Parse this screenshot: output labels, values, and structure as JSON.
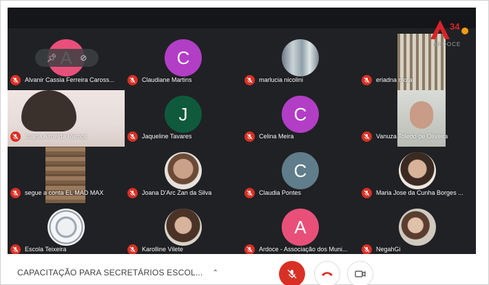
{
  "meeting": {
    "title": "CAPACITAÇÃO PARA SECRETÁRIOS ESCOL...",
    "expand_icon": "chevron-up-icon"
  },
  "logo": {
    "text": "ARDOCE",
    "number": "34"
  },
  "pinned_tile_initial": "A",
  "participants": [
    {
      "name": "Alvanir Cassia Ferreira Caross...",
      "kind": "initial",
      "initial": "A",
      "color": "#e8507a"
    },
    {
      "name": "Claudiane Martins",
      "kind": "initial",
      "initial": "C",
      "color": "#b23ec6"
    },
    {
      "name": "marlucia nicolini",
      "kind": "photo"
    },
    {
      "name": "eriadna mota",
      "kind": "video"
    },
    {
      "name": "Luana Almeida Ramos",
      "kind": "video"
    },
    {
      "name": "Jaqueline Tavares",
      "kind": "initial",
      "initial": "J",
      "color": "#0f5a3d"
    },
    {
      "name": "Celina Meira",
      "kind": "initial",
      "initial": "C",
      "color": "#b23ec6"
    },
    {
      "name": "Vanuza Toledo de Oliveira",
      "kind": "video"
    },
    {
      "name": "segue a conta EL MAD MAX",
      "kind": "video"
    },
    {
      "name": "Joana D'Arc Zan da Silva",
      "kind": "photo"
    },
    {
      "name": "Claudia Pontes",
      "kind": "initial",
      "initial": "C",
      "color": "#607d8b"
    },
    {
      "name": "Maria Jose da Cunha Borges ...",
      "kind": "photo"
    },
    {
      "name": "Escola Teixeira",
      "kind": "photo"
    },
    {
      "name": "Karolline Vilete",
      "kind": "photo"
    },
    {
      "name": "Ardoce - Associação dos Muni...",
      "kind": "initial",
      "initial": "A",
      "color": "#e8507a"
    },
    {
      "name": "NegahGi",
      "kind": "photo"
    }
  ],
  "controls": {
    "mic": "mic-off-icon",
    "hangup": "hangup-icon",
    "camera": "camera-icon"
  },
  "colors": {
    "muted": "#d93025",
    "stage": "#202124"
  }
}
